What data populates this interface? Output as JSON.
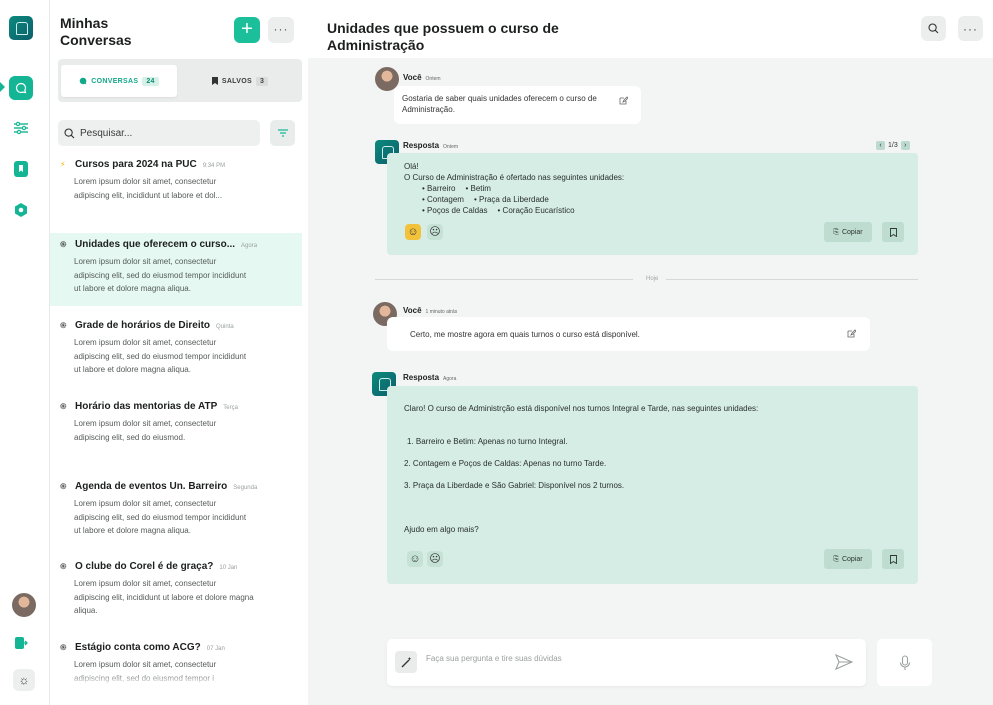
{
  "conversations_panel": {
    "title": "Minhas Conversas",
    "tabs": [
      {
        "label": "CONVERSAS",
        "count": "24"
      },
      {
        "label": "SALVOS",
        "count": "3"
      }
    ],
    "search_placeholder": "Pesquisar...",
    "items": [
      {
        "title": "Cursos para 2024 na PUC",
        "time": "9:34 PM",
        "text": "Lorem ipsum dolor sit amet, consectetur adipiscing elit, incididunt ut labore et dol..."
      },
      {
        "title": "Unidades que oferecem o curso...",
        "time": "Agora",
        "text": "Lorem ipsum dolor sit amet, consectetur adipiscing elit, sed do eiusmod tempor incididunt ut labore et dolore magna aliqua."
      },
      {
        "title": "Grade de horários de Direito",
        "time": "Quinta",
        "text": "Lorem ipsum dolor sit amet, consectetur adipiscing elit, sed do eiusmod tempor incididunt ut labore et dolore magna aliqua."
      },
      {
        "title": "Horário das mentorias de ATP",
        "time": "Terça",
        "text": "Lorem ipsum dolor sit amet, consectetur adipiscing elit, sed do eiusmod."
      },
      {
        "title": "Agenda de eventos Un. Barreiro",
        "time": "Segunda",
        "text": "Lorem ipsum dolor sit amet, consectetur adipiscing elit, sed do eiusmod tempor incididunt ut labore et dolore magna aliqua."
      },
      {
        "title": "O clube do Corel é de graça?",
        "time": "10 Jan",
        "text": "Lorem ipsum dolor sit amet, consectetur adipiscing elit, incididunt ut labore et dolore magna aliqua."
      },
      {
        "title": "Estágio conta como ACG?",
        "time": "07 Jan",
        "text": "Lorem ipsum dolor sit amet, consectetur adipiscing elit, sed do eiusmod tempor i"
      }
    ]
  },
  "chat": {
    "title": "Unidades que possuem o curso de Administração",
    "messages": {
      "user1": {
        "name": "Você",
        "time": "Ontem",
        "text": "Gostaria de saber quais unidades oferecem o curso de Administração."
      },
      "bot1": {
        "name": "Resposta",
        "time": "Ontem",
        "pager": "1/3",
        "greeting": "Olá!",
        "intro": "O Curso de Administração é ofertado nas seguintes unidades:",
        "units": [
          "Barreiro",
          "Betim",
          "Contagem",
          "Praça da Liberdade",
          "Poços de Caldas",
          "Coração Eucarístico"
        ],
        "copy_label": "Copiar"
      },
      "divider": "Hoje",
      "user2": {
        "name": "Você",
        "time": "1 minuto atrás",
        "text": "Certo, me mostre agora em quais turnos o curso está disponível."
      },
      "bot2": {
        "name": "Resposta",
        "time": "Agora",
        "intro": "Claro! O curso de Administrção está disponível nos turnos Integral e Tarde, nas seguintes unidades:",
        "lines": [
          "1. Barreiro e Betim: Apenas no turno Integral.",
          "2. Contagem e Poços de Caldas: Apenas no turno Tarde.",
          "3. Praça da Liberdade e São Gabriel: Disponível nos 2 turnos."
        ],
        "closing": "Ajudo em algo mais?",
        "copy_label": "Copiar"
      }
    },
    "composer_placeholder": "Faça sua pergunta e tire suas dúvidas"
  },
  "colors": {
    "accent": "#1bbf99",
    "bot_bubble": "#d5ede4",
    "active_conv": "#e5f8f2"
  },
  "icons": [
    "app-logo-icon",
    "chat-icon",
    "sliders-icon",
    "bookmark-icon",
    "hexagon-icon",
    "logout-icon",
    "theme-icon",
    "search-icon",
    "filter-icon",
    "edit-icon",
    "smile-icon",
    "sad-icon",
    "copy-icon",
    "send-icon",
    "mic-icon",
    "magic-wand-icon"
  ]
}
